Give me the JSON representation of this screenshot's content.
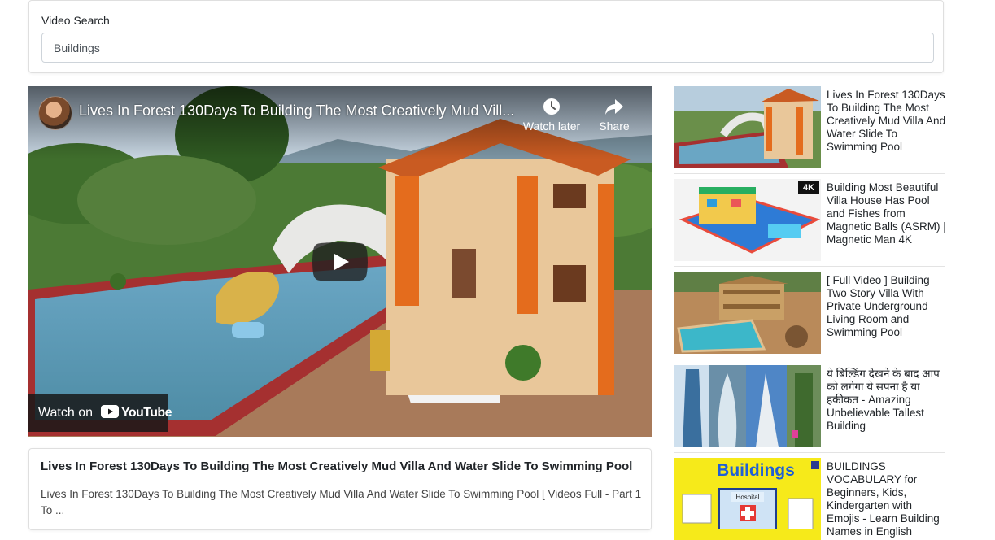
{
  "search": {
    "label": "Video Search",
    "value": "Buildings",
    "placeholder": ""
  },
  "player": {
    "title": "Lives In Forest 130Days To Building The Most Creatively Mud Vill...",
    "watch_later_label": "Watch later",
    "share_label": "Share",
    "watch_on_label": "Watch on",
    "youtube_label": "YouTube",
    "icons": [
      "channel-avatar",
      "clock-icon",
      "share-arrow-icon",
      "play-icon",
      "youtube-logo-icon"
    ]
  },
  "selected_video": {
    "title": "Lives In Forest 130Days To Building The Most Creatively Mud Villa And Water Slide To Swimming Pool",
    "description": "Lives In Forest 130Days To Building The Most Creatively Mud Villa And Water Slide To Swimming Pool [ Videos Full - Part 1 To ..."
  },
  "related": [
    {
      "title": "Lives In Forest 130Days To Building The Most Creatively Mud Villa And Water Slide To Swimming Pool"
    },
    {
      "title": "Building Most Beautiful Villa House Has Pool and Fishes from Magnetic Balls (ASRM) | Magnetic Man 4K",
      "badge": "4K"
    },
    {
      "title": "[ Full Video ] Building Two Story Villa With Private Underground Living Room and Swimming Pool"
    },
    {
      "title": "ये बिल्डिंग देखने के बाद आप को लगेगा ये सपना है या हकीकत - Amazing Unbelievable Tallest Building"
    },
    {
      "title": "BUILDINGS VOCABULARY for Beginners, Kids, Kindergarten with Emojis - Learn Building Names in English",
      "thumb_text": "Buildings",
      "thumb_sign": "Hospital"
    }
  ],
  "colors": {
    "border": "#dfdfdf",
    "youtube_red": "#ff0000"
  }
}
